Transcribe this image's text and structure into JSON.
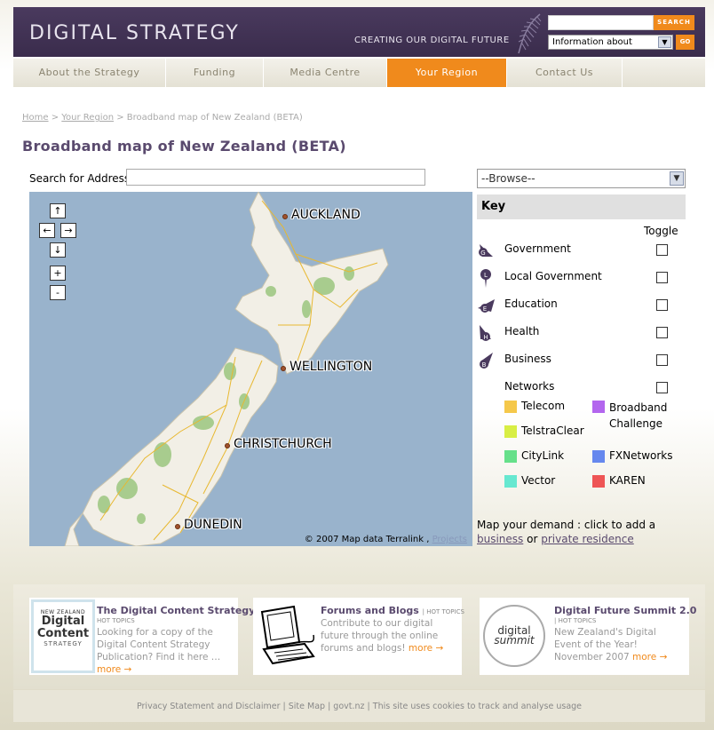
{
  "header": {
    "logo": "DIGITAL STRATEGY",
    "tagline": "CREATING OUR DIGITAL FUTURE",
    "search_label": "SEARCH",
    "info_select": "Information about",
    "go_label": "GO"
  },
  "nav": [
    {
      "label": "About the Strategy",
      "active": false
    },
    {
      "label": "Funding",
      "active": false
    },
    {
      "label": "Media Centre",
      "active": false
    },
    {
      "label": "Your Region",
      "active": true
    },
    {
      "label": "Contact Us",
      "active": false
    }
  ],
  "breadcrumb": {
    "home": "Home",
    "region": "Your Region",
    "current": "Broadband map of New Zealand (BETA)"
  },
  "page_title": "Broadband map of New Zealand (BETA)",
  "address": {
    "label": "Search for Address",
    "value": ""
  },
  "map": {
    "controls": {
      "up": "↑",
      "left": "←",
      "right": "→",
      "down": "↓",
      "zoom_in": "+",
      "zoom_out": "-"
    },
    "cities": {
      "auckland": "AUCKLAND",
      "wellington": "WELLINGTON",
      "christchurch": "CHRISTCHURCH",
      "dunedin": "DUNEDIN"
    },
    "copyright": "© 2007 Map data Terralink ,",
    "copyright_link": "Projects"
  },
  "browse": "--Browse--",
  "key": {
    "heading": "Key",
    "toggle_label": "Toggle",
    "items": [
      {
        "label": "Government",
        "icon_letter": "G"
      },
      {
        "label": "Local Government",
        "icon_letter": "L"
      },
      {
        "label": "Education",
        "icon_letter": "E"
      },
      {
        "label": "Health",
        "icon_letter": "H"
      },
      {
        "label": "Business",
        "icon_letter": "B"
      },
      {
        "label": "Networks",
        "icon_letter": ""
      }
    ],
    "networks": [
      {
        "label": "Telecom",
        "color": "#f5c84a"
      },
      {
        "label": "Broadband Challenge",
        "color": "#b366ee"
      },
      {
        "label": "TelstraClear",
        "color": "#d8ee44"
      },
      {
        "label": "CityLink",
        "color": "#66e08a"
      },
      {
        "label": "FXNetworks",
        "color": "#6688ee"
      },
      {
        "label": "Vector",
        "color": "#66e8d0"
      },
      {
        "label": "KAREN",
        "color": "#ee5555"
      }
    ]
  },
  "demand": {
    "text": "Map your demand : click to add a",
    "business": "business",
    "or": "or",
    "residence": "private residence"
  },
  "promos": [
    {
      "title": "The Digital Content Strategy",
      "hot": "HOT TOPICS",
      "text": "Looking for a copy of the Digital Content Strategy Publication? Find it here …",
      "more": "more →",
      "img_lines": [
        "NEW ZEALAND",
        "Digital",
        "Content",
        "STRATEGY"
      ]
    },
    {
      "title": "Forums and Blogs",
      "hot": "HOT TOPICS",
      "text": "Contribute to our digital future through the online forums and blogs!",
      "more": "more →"
    },
    {
      "title": "Digital Future Summit 2.0",
      "hot": "HOT TOPICS",
      "text": "New Zealand's Digital Event of the Year! November 2007",
      "more": "more →",
      "img_lines": [
        "digital",
        "summit"
      ]
    }
  ],
  "footer": "Privacy Statement and Disclaimer | Site Map | govt.nz | This site uses cookies to track and analyse usage",
  "colors": {
    "brand_purple": "#4a3a5e",
    "accent_orange": "#f08a1c",
    "sea": "#99b3cc",
    "land": "#f2efe6"
  }
}
